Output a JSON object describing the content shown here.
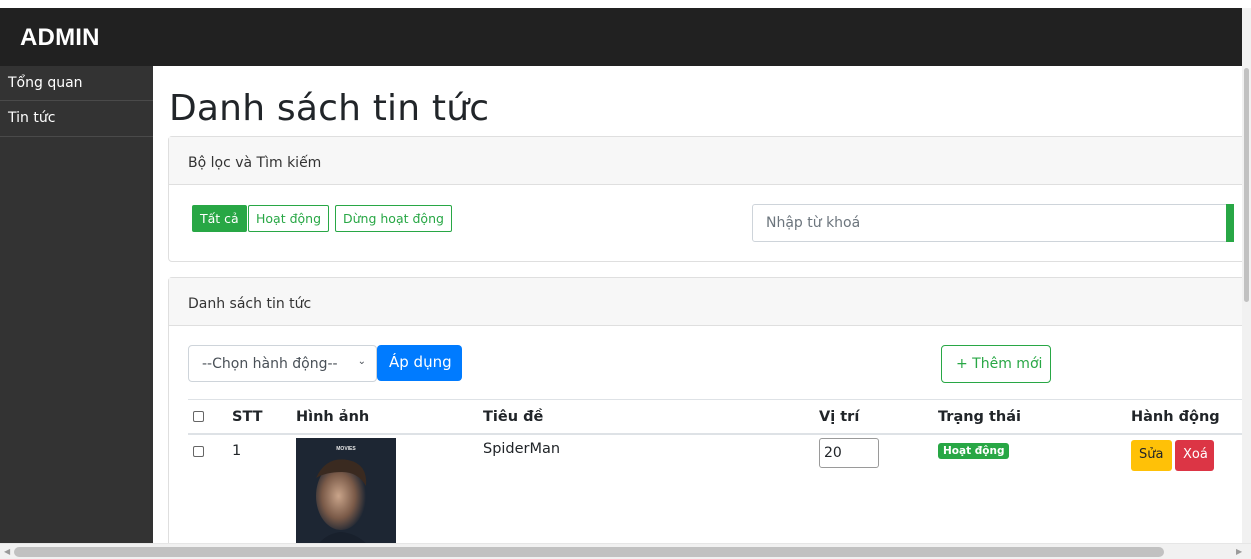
{
  "header": {
    "brand": "ADMIN"
  },
  "sidebar": {
    "items": [
      {
        "label": "Tổng quan"
      },
      {
        "label": "Tin tức"
      }
    ]
  },
  "page": {
    "title": "Danh sách tin tức"
  },
  "filter_card": {
    "title": "Bộ lọc và Tìm kiếm",
    "filters": [
      {
        "label": "Tất cả",
        "active": true
      },
      {
        "label": "Hoạt động",
        "active": false
      },
      {
        "label": "Dừng hoạt động",
        "active": false
      }
    ],
    "search": {
      "placeholder": "Nhập từ khoá",
      "value": ""
    }
  },
  "list_card": {
    "title": "Danh sách tin tức",
    "action_select": {
      "selected": "--Chọn hành động--"
    },
    "apply_label": "Áp dụng",
    "add_label": "+ Thêm mới",
    "columns": [
      "STT",
      "Hình ảnh",
      "Tiêu đề",
      "Vị trí",
      "Trạng thái",
      "Hành động"
    ],
    "rows": [
      {
        "stt": "1",
        "image_caption": "MOVIES",
        "title": "SpiderMan",
        "position": "20",
        "status": "Hoạt động",
        "edit_label": "Sửa",
        "delete_label": "Xoá"
      }
    ]
  },
  "colors": {
    "header_bg": "#212121",
    "sidebar_bg": "#333333",
    "success": "#28a745",
    "primary": "#007bff",
    "warning": "#ffc107",
    "danger": "#dc3545"
  }
}
